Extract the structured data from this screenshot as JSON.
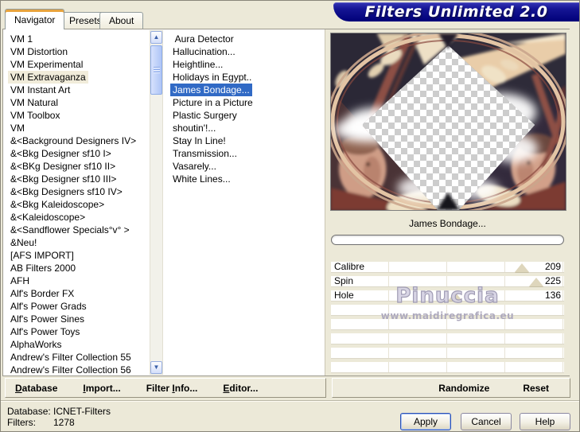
{
  "window": {
    "title": "Filters Unlimited 2.0"
  },
  "tabs": [
    {
      "label": "Navigator",
      "active": true
    },
    {
      "label": "Presets",
      "active": false
    },
    {
      "label": "About",
      "active": false
    }
  ],
  "category_list": {
    "selected_index": 3,
    "items": [
      "VM 1",
      "VM Distortion",
      "VM Experimental",
      "VM Extravaganza",
      "VM Instant Art",
      "VM Natural",
      "VM Toolbox",
      "VM",
      "&<Background Designers IV>",
      "&<Bkg Designer sf10 I>",
      "&<BKg Designer sf10 II>",
      "&<Bkg Designer sf10 III>",
      "&<Bkg Designers sf10 IV>",
      "&<Bkg Kaleidoscope>",
      "&<Kaleidoscope>",
      "&<Sandflower Specials°v° >",
      "&Neu!",
      "[AFS IMPORT]",
      "AB Filters 2000",
      "AFH",
      "Alf's Border FX",
      "Alf's Power Grads",
      "Alf's Power Sines",
      "Alf's Power Toys",
      "AlphaWorks",
      "Andrew's Filter Collection 55",
      "Andrew's Filter Collection 56"
    ]
  },
  "filter_list": {
    "selected_index": 4,
    "items": [
      " Aura Detector",
      "Hallucination...",
      "Heightline...",
      "Holidays in Egypt..",
      "James Bondage...",
      "Picture in a Picture",
      "Plastic Surgery",
      "shoutin'!...",
      "Stay In Line!",
      "Transmission...",
      "Vasarely...",
      "White Lines..."
    ]
  },
  "preview": {
    "filter_name": "James Bondage...",
    "watermark": {
      "title": "Pinuccia",
      "url": "www.maidiregrafica.eu"
    }
  },
  "sliders": {
    "max": 255,
    "rows": [
      {
        "label": "Calibre",
        "value": 209
      },
      {
        "label": "Spin",
        "value": 225
      },
      {
        "label": "Hole",
        "value": 136
      },
      {},
      {},
      {},
      {},
      {}
    ]
  },
  "toolbar": {
    "database": {
      "pre": "",
      "key": "D",
      "post": "atabase"
    },
    "import_": {
      "pre": "",
      "key": "I",
      "post": "mport..."
    },
    "filter_info": {
      "pre": "Filter ",
      "key": "I",
      "post": "nfo..."
    },
    "editor": {
      "pre": "",
      "key": "E",
      "post": "ditor..."
    },
    "randomize": "Randomize",
    "reset": "Reset"
  },
  "status": {
    "rows": [
      {
        "label": "Database:",
        "value": "ICNET-Filters"
      },
      {
        "label": "Filters:",
        "value": "1278"
      }
    ]
  },
  "dialog_buttons": {
    "apply": "Apply",
    "cancel": "Cancel",
    "help": "Help"
  },
  "icons": {
    "scroll_up": "▲",
    "scroll_down": "▼"
  },
  "colors": {
    "window_bg": "#ece9d8",
    "banner_blue": "#000080",
    "selection_blue": "#316ac5",
    "tab_accent_orange": "#e8a33d"
  }
}
